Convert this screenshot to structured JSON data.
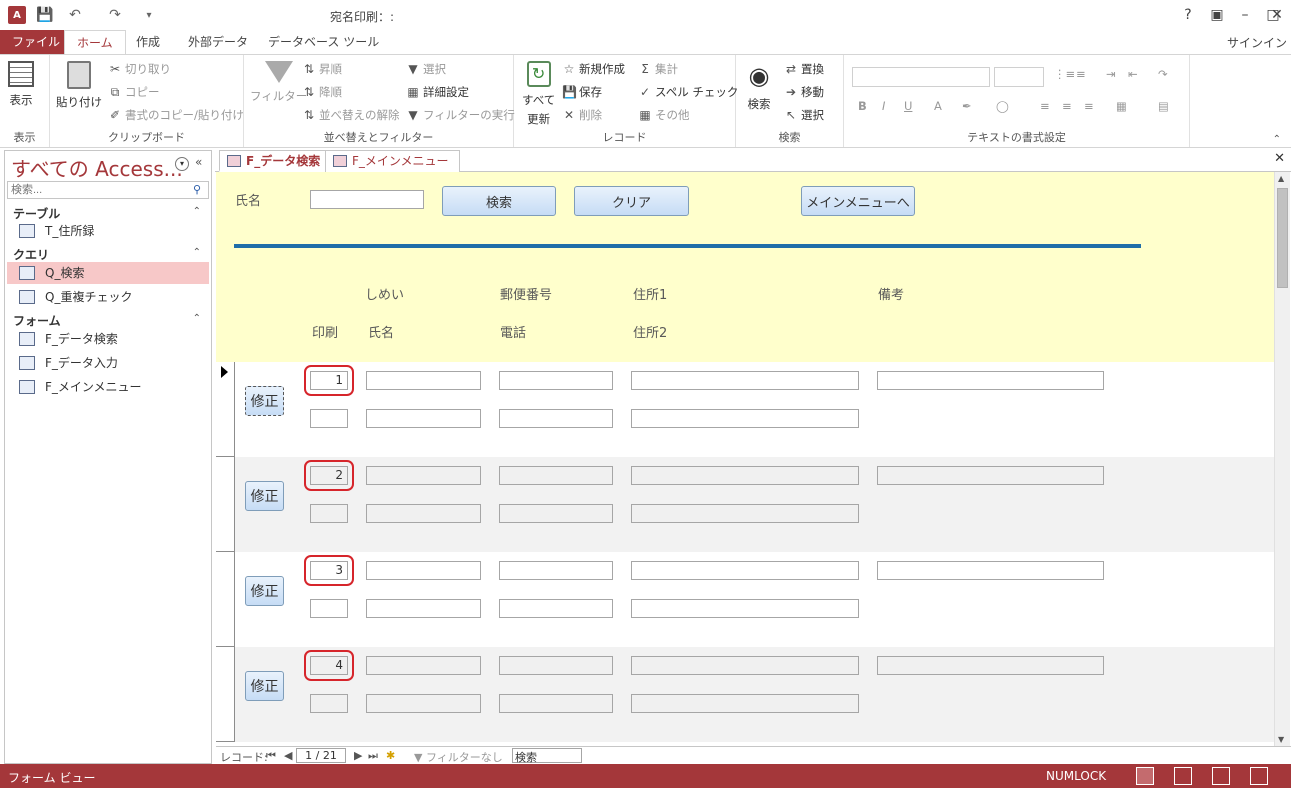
{
  "window": {
    "title": "宛名印刷：:",
    "help": "?",
    "signin": "サインイン"
  },
  "ribbon_tabs": [
    "ファイル",
    "ホーム",
    "作成",
    "外部データ",
    "データベース ツール"
  ],
  "ribbon": {
    "view": {
      "label": "表示",
      "group": "表示"
    },
    "clipboard": {
      "paste": "貼り付け",
      "cut": "切り取り",
      "copy": "コピー",
      "format_painter": "書式のコピー/貼り付け",
      "group": "クリップボード"
    },
    "sort_filter": {
      "filter": "フィルター",
      "ascending": "昇順",
      "descending": "降順",
      "clear_sort": "並べ替えの解除",
      "selection": "選択",
      "advanced": "詳細設定",
      "toggle_filter": "フィルターの実行",
      "group": "並べ替えとフィルター"
    },
    "records": {
      "refresh": "すべて\n更新",
      "refresh_line1": "すべて",
      "refresh_line2": "更新",
      "new": "新規作成",
      "save": "保存",
      "delete": "削除",
      "totals": "集計",
      "spelling": "スペル チェック",
      "more": "その他",
      "group": "レコード"
    },
    "find": {
      "find": "検索",
      "replace": "置換",
      "goto": "移動",
      "select": "選択",
      "group": "検索"
    },
    "text_format": {
      "group": "テキストの書式設定",
      "bold": "B",
      "italic": "I",
      "underline": "U",
      "font_color": "A"
    }
  },
  "nav_pane": {
    "title": "すべての Access...",
    "search_placeholder": "検索...",
    "sections": [
      {
        "label": "テーブル",
        "items": [
          "T_住所録"
        ]
      },
      {
        "label": "クエリ",
        "items": [
          "Q_検索",
          "Q_重複チェック"
        ]
      },
      {
        "label": "フォーム",
        "items": [
          "F_データ検索",
          "F_データ入力",
          "F_メインメニュー"
        ]
      }
    ]
  },
  "doc_tabs": [
    "F_データ検索",
    "F_メインメニュー"
  ],
  "form": {
    "name_label": "氏名",
    "search_button": "検索",
    "clear_button": "クリア",
    "main_menu_button": "メインメニューへ",
    "col_headers": {
      "kana": "しめい",
      "zip": "郵便番号",
      "addr1": "住所1",
      "note": "備考",
      "print": "印刷",
      "name": "氏名",
      "phone": "電話",
      "addr2": "住所2"
    },
    "edit_button": "修正",
    "records": [
      {
        "no": "1"
      },
      {
        "no": "2"
      },
      {
        "no": "3"
      },
      {
        "no": "4"
      }
    ]
  },
  "record_nav": {
    "label": "レコード:",
    "current": "1 / 21",
    "filter": "フィルターなし",
    "search": "検索"
  },
  "status": {
    "left": "フォーム ビュー",
    "numlock": "NUMLOCK"
  },
  "colors": {
    "accent": "#a4373a",
    "header_bg": "#ffffcc",
    "rule": "#1f6ea9",
    "highlight_ring": "#d6252b"
  }
}
